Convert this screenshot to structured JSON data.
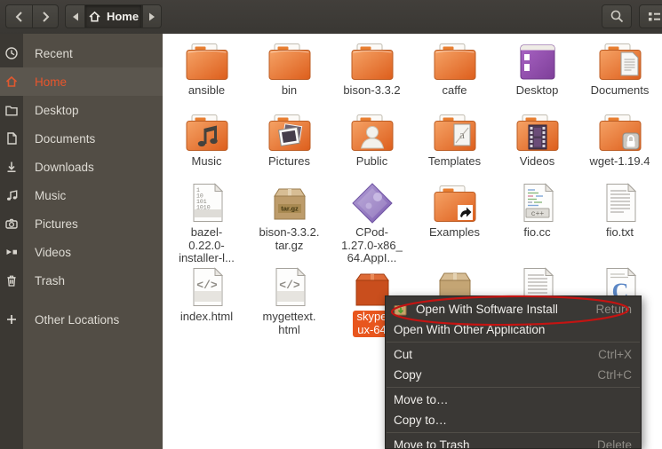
{
  "toolbar": {
    "location_label": "Home"
  },
  "sidebar": {
    "items": [
      {
        "label": "Recent",
        "icon": "clock-icon"
      },
      {
        "label": "Home",
        "icon": "home-icon",
        "active": true
      },
      {
        "label": "Desktop",
        "icon": "folder-icon"
      },
      {
        "label": "Documents",
        "icon": "document-icon"
      },
      {
        "label": "Downloads",
        "icon": "download-icon"
      },
      {
        "label": "Music",
        "icon": "music-note-icon"
      },
      {
        "label": "Pictures",
        "icon": "camera-icon"
      },
      {
        "label": "Videos",
        "icon": "video-icon"
      },
      {
        "label": "Trash",
        "icon": "trash-icon"
      },
      {
        "label": "Other Locations",
        "icon": "plus-icon"
      }
    ]
  },
  "files": [
    {
      "name": "ansible",
      "icon": "folder"
    },
    {
      "name": "bin",
      "icon": "folder"
    },
    {
      "name": "bison-3.3.2",
      "icon": "folder"
    },
    {
      "name": "caffe",
      "icon": "folder"
    },
    {
      "name": "Desktop",
      "icon": "desktop"
    },
    {
      "name": "Documents",
      "icon": "folder-documents"
    },
    {
      "name": "Music",
      "icon": "folder-music"
    },
    {
      "name": "Pictures",
      "icon": "folder-pictures"
    },
    {
      "name": "Public",
      "icon": "folder-public"
    },
    {
      "name": "Templates",
      "icon": "folder-templates"
    },
    {
      "name": "Videos",
      "icon": "folder-videos"
    },
    {
      "name": "wget-1.19.4",
      "icon": "folder-locked"
    },
    {
      "name": "bazel-\n0.22.0-\ninstaller-l...",
      "icon": "binary-file"
    },
    {
      "name": "bison-3.3.2.\ntar.gz",
      "icon": "tar-archive"
    },
    {
      "name": "CPod-\n1.27.0-x86_\n64.AppI...",
      "icon": "appimage"
    },
    {
      "name": "Examples",
      "icon": "folder-shortcut"
    },
    {
      "name": "fio.cc",
      "icon": "cpp-file"
    },
    {
      "name": "fio.txt",
      "icon": "text-file"
    },
    {
      "name": "index.html",
      "icon": "html-file"
    },
    {
      "name": "mygettext.\nhtml",
      "icon": "html-file"
    },
    {
      "name": "skype\nux-64",
      "icon": "deb-package",
      "selected": true
    },
    {
      "name": "",
      "icon": "tar-archive-partial"
    },
    {
      "name": "",
      "icon": "text-file-partial"
    },
    {
      "name": "",
      "icon": "c-file-partial"
    }
  ],
  "context_menu": {
    "items": [
      {
        "label": "Open With Software Install",
        "accel": "Return",
        "icon": "software-install-icon",
        "annotated": true
      },
      {
        "label": "Open With Other Application",
        "accel": ""
      },
      {
        "label": "Cut",
        "accel": "Ctrl+X"
      },
      {
        "label": "Copy",
        "accel": "Ctrl+C"
      },
      {
        "label": "Move to…",
        "accel": ""
      },
      {
        "label": "Copy to…",
        "accel": ""
      },
      {
        "label": "Move to Trash",
        "accel": "Delete"
      }
    ]
  },
  "annotation": {
    "shape": "hand-drawn-ellipse",
    "color": "#C41412",
    "target": "Open With Software Install"
  },
  "colors": {
    "accent_orange": "#E95420",
    "selection_label": "#E8561E",
    "toolbar_bg": "#3E3C38",
    "sidebar_bg": "#524D45",
    "menu_bg": "#3A3835",
    "main_bg": "#FFFFFF"
  }
}
